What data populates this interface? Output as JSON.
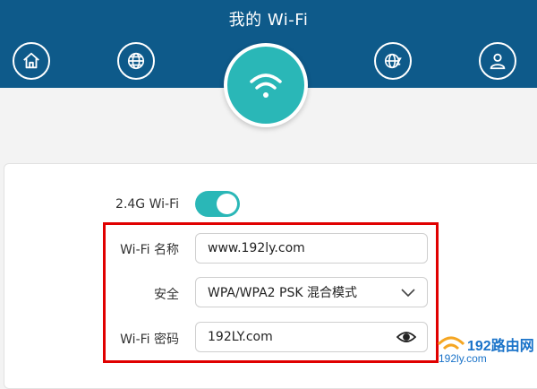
{
  "header": {
    "title": "我的 Wi-Fi",
    "nav": [
      {
        "icon": "home-icon"
      },
      {
        "icon": "globe-icon"
      },
      {
        "icon": "wifi-icon"
      },
      {
        "icon": "internet-settings-icon"
      },
      {
        "icon": "user-icon"
      }
    ]
  },
  "settings": {
    "wifi_24g_label": "2.4G Wi-Fi",
    "wifi_24g_enabled": true,
    "ssid_label": "Wi-Fi 名称",
    "ssid_value": "www.192ly.com",
    "security_label": "安全",
    "security_value": "WPA/WPA2 PSK 混合模式",
    "password_label": "Wi-Fi 密码",
    "password_value": "192LY.com"
  },
  "watermark": {
    "main": "192路由网",
    "sub": "192ly.com"
  },
  "colors": {
    "header": "#0e5a8a",
    "accent": "#2ab7b7",
    "highlight": "#e00000"
  }
}
